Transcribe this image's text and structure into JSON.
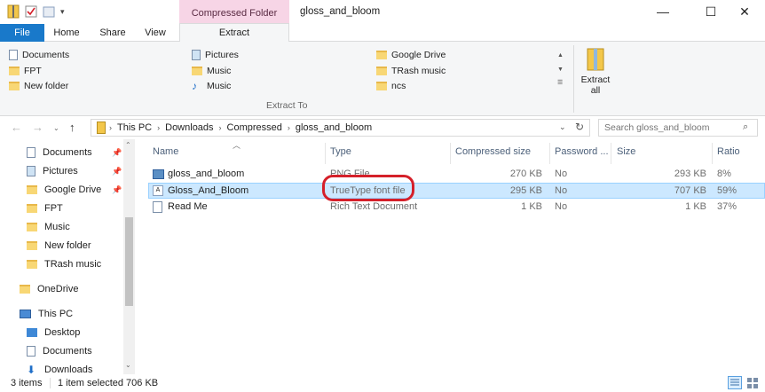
{
  "title_bar": {
    "context_tab_header": "Compressed Folder Tools",
    "window_title": "gloss_and_bloom",
    "minimize_glyph": "—",
    "maximize_glyph": "☐",
    "close_glyph": "✕"
  },
  "ribbon_tabs": {
    "file": "File",
    "home": "Home",
    "share": "Share",
    "view": "View",
    "extract": "Extract"
  },
  "ribbon": {
    "destinations": [
      {
        "label": "Documents",
        "icon": "documents-icon"
      },
      {
        "label": "FPT",
        "icon": "folder-icon"
      },
      {
        "label": "New folder",
        "icon": "folder-icon"
      },
      {
        "label": "Pictures",
        "icon": "pictures-icon"
      },
      {
        "label": "Music",
        "icon": "folder-icon"
      },
      {
        "label": "Music",
        "icon": "music-icon"
      },
      {
        "label": "Google Drive",
        "icon": "folder-icon"
      },
      {
        "label": "TRash music",
        "icon": "folder-icon"
      },
      {
        "label": "ncs",
        "icon": "folder-icon"
      }
    ],
    "group_label": "Extract To",
    "extract_all_line1": "Extract",
    "extract_all_line2": "all"
  },
  "address_bar": {
    "crumbs": [
      "This PC",
      "Downloads",
      "Compressed",
      "gloss_and_bloom"
    ],
    "search_placeholder": "Search gloss_and_bloom"
  },
  "nav_pane": {
    "quick_access": [
      {
        "label": "Documents",
        "pinned": true
      },
      {
        "label": "Pictures",
        "pinned": true
      },
      {
        "label": "Google Drive",
        "pinned": true
      },
      {
        "label": "FPT",
        "pinned": false
      },
      {
        "label": "Music",
        "pinned": false
      },
      {
        "label": "New folder",
        "pinned": false
      },
      {
        "label": "TRash music",
        "pinned": false
      }
    ],
    "onedrive": "OneDrive",
    "this_pc": "This PC",
    "this_pc_children": [
      "Desktop",
      "Documents",
      "Downloads"
    ]
  },
  "file_list": {
    "columns": [
      "Name",
      "Type",
      "Compressed size",
      "Password ...",
      "Size",
      "Ratio"
    ],
    "rows": [
      {
        "name": "gloss_and_bloom",
        "type": "PNG File",
        "compressed": "270 KB",
        "password": "No",
        "size": "293 KB",
        "ratio": "8%",
        "selected": false
      },
      {
        "name": "Gloss_And_Bloom",
        "type": "TrueType font file",
        "compressed": "295 KB",
        "password": "No",
        "size": "707 KB",
        "ratio": "59%",
        "selected": true
      },
      {
        "name": "Read Me",
        "type": "Rich Text Document",
        "compressed": "1 KB",
        "password": "No",
        "size": "1 KB",
        "ratio": "37%",
        "selected": false
      }
    ]
  },
  "status_bar": {
    "item_count": "3 items",
    "selection": "1 item selected  706 KB"
  },
  "colors": {
    "file_tab_blue": "#1979ca",
    "context_tab_pink": "#f7d5e6",
    "selection_blue": "#cce8ff",
    "annotation_red": "#d5202a",
    "folder_yellow": "#f8d775"
  }
}
